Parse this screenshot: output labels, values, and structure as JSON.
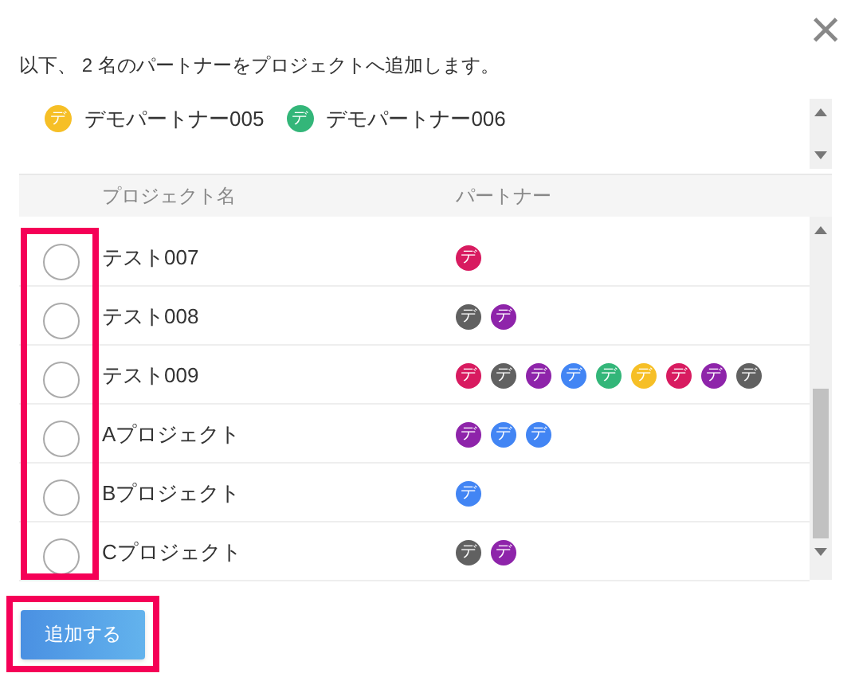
{
  "message": "以下、 2 名のパートナーをプロジェクトへ追加します。",
  "close": "×",
  "partners": [
    {
      "avatar": "デ",
      "name": "デモパートナー005",
      "color": "#f6bf26"
    },
    {
      "avatar": "デ",
      "name": "デモパートナー006",
      "color": "#33b679"
    }
  ],
  "table": {
    "columns": [
      "プロジェクト名",
      "パートナー"
    ],
    "rows": [
      {
        "checked": false,
        "name": "テスト007",
        "partners": [
          {
            "avatar": "デ",
            "color": "#d81b60"
          }
        ]
      },
      {
        "checked": false,
        "name": "テスト008",
        "partners": [
          {
            "avatar": "デ",
            "color": "#616161"
          },
          {
            "avatar": "デ",
            "color": "#8e24aa"
          }
        ]
      },
      {
        "checked": false,
        "name": "テスト009",
        "partners": [
          {
            "avatar": "デ",
            "color": "#d81b60"
          },
          {
            "avatar": "デ",
            "color": "#616161"
          },
          {
            "avatar": "デ",
            "color": "#8e24aa"
          },
          {
            "avatar": "デ",
            "color": "#4285f4"
          },
          {
            "avatar": "デ",
            "color": "#33b679"
          },
          {
            "avatar": "デ",
            "color": "#f6bf26"
          },
          {
            "avatar": "デ",
            "color": "#d81b60"
          },
          {
            "avatar": "デ",
            "color": "#8e24aa"
          },
          {
            "avatar": "デ",
            "color": "#616161"
          }
        ]
      },
      {
        "checked": false,
        "name": "Aプロジェクト",
        "partners": [
          {
            "avatar": "デ",
            "color": "#8e24aa"
          },
          {
            "avatar": "デ",
            "color": "#4285f4"
          },
          {
            "avatar": "デ",
            "color": "#4285f4"
          }
        ]
      },
      {
        "checked": false,
        "name": "Bプロジェクト",
        "partners": [
          {
            "avatar": "デ",
            "color": "#4285f4"
          }
        ]
      },
      {
        "checked": false,
        "name": "Cプロジェクト",
        "partners": [
          {
            "avatar": "デ",
            "color": "#616161"
          },
          {
            "avatar": "デ",
            "color": "#8e24aa"
          }
        ]
      }
    ]
  },
  "add_button": "追加する"
}
